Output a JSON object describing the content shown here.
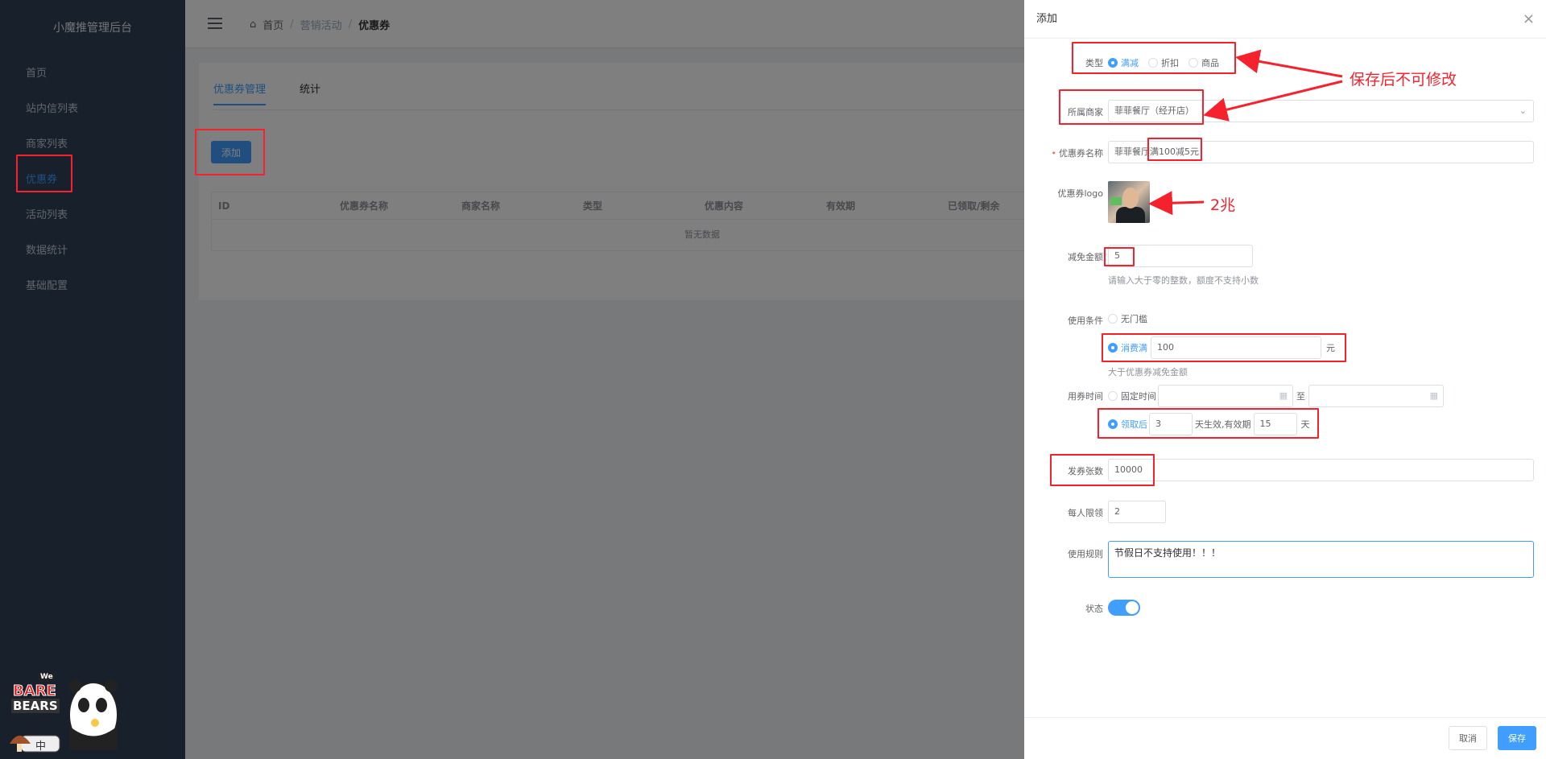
{
  "sidebar": {
    "brand": "小魔推管理后台",
    "items": [
      {
        "label": "首页"
      },
      {
        "label": "站内信列表"
      },
      {
        "label": "商家列表"
      },
      {
        "label": "优惠券"
      },
      {
        "label": "活动列表"
      },
      {
        "label": "数据统计"
      },
      {
        "label": "基础配置"
      }
    ]
  },
  "breadcrumb": {
    "home": "首页",
    "section": "营销活动",
    "current": "优惠券"
  },
  "page": {
    "tabs": [
      "优惠券管理",
      "统计"
    ],
    "add_button": "添加",
    "table": {
      "columns": [
        "ID",
        "优惠券名称",
        "商家名称",
        "类型",
        "优惠内容",
        "有效期",
        "已领取/剩余"
      ],
      "empty_text": "暂无数据"
    }
  },
  "drawer": {
    "title": "添加",
    "type": {
      "label": "类型",
      "options": [
        "满减",
        "折扣",
        "商品"
      ],
      "selected": "满减"
    },
    "merchant": {
      "label": "所属商家",
      "value": "菲菲餐厅（经开店）"
    },
    "name": {
      "label": "优惠券名称",
      "value": "菲菲餐厅满100减5元"
    },
    "logo": {
      "label": "优惠券logo"
    },
    "discount": {
      "label": "减免金额",
      "value": "5",
      "hint": "请输入大于零的整数，额度不支持小数"
    },
    "condition": {
      "label": "使用条件",
      "option_none": "无门槛",
      "option_min": "消费满",
      "min_value": "100",
      "unit": "元",
      "hint": "大于优惠券减免金额"
    },
    "time": {
      "label": "用券时间",
      "option_fixed": "固定时间",
      "to": "至",
      "option_after": "领取后",
      "after_days": "3",
      "mid_text": "天生效,有效期",
      "valid_days": "15",
      "unit": "天"
    },
    "count": {
      "label": "发券张数",
      "value": "10000"
    },
    "limit": {
      "label": "每人限领",
      "value": "2"
    },
    "rules": {
      "label": "使用规则",
      "value": "节假日不支持使用！！！"
    },
    "status": {
      "label": "状态",
      "on": true
    },
    "cancel": "取消",
    "save": "保存"
  },
  "annotations": {
    "no_edit": "保存后不可修改",
    "size": "2兆"
  },
  "mascot": {
    "brand_top": "We",
    "brand_main": "BARE",
    "brand_sub": "BEARS",
    "badge": "中"
  },
  "colors": {
    "sidebar_bg": "#304156",
    "primary": "#409eff",
    "annotation": "#f5222d"
  }
}
